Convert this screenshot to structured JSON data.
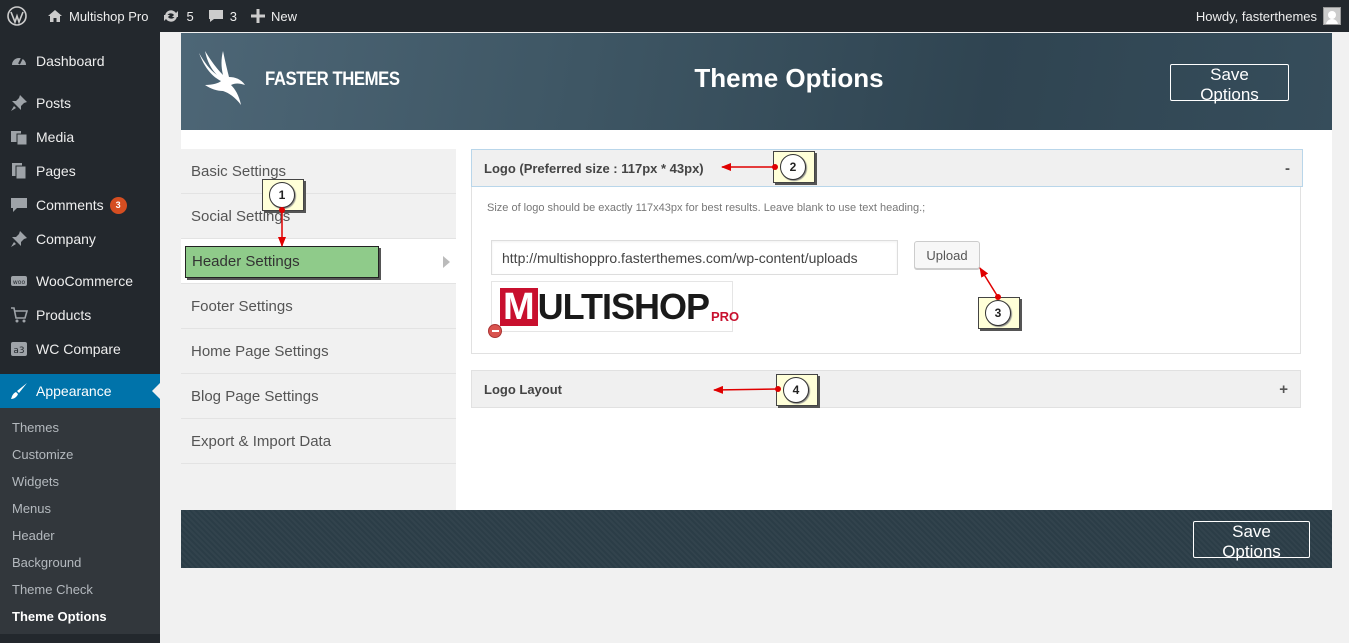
{
  "adminbar": {
    "site_name": "Multishop Pro",
    "updates_count": "5",
    "comments_count": "3",
    "new_label": "New",
    "howdy": "Howdy, fasterthemes"
  },
  "sidebar": {
    "items": [
      {
        "label": "Dashboard",
        "icon": "dashboard-icon"
      },
      {
        "label": "Posts",
        "icon": "pin-icon"
      },
      {
        "label": "Media",
        "icon": "media-icon"
      },
      {
        "label": "Pages",
        "icon": "pages-icon"
      },
      {
        "label": "Comments",
        "icon": "comments-icon",
        "badge": "3"
      },
      {
        "label": "Company",
        "icon": "pin-icon"
      },
      {
        "label": "WooCommerce",
        "icon": "woo-icon"
      },
      {
        "label": "Products",
        "icon": "cart-icon"
      },
      {
        "label": "WC Compare",
        "icon": "compare-icon"
      },
      {
        "label": "Appearance",
        "icon": "brush-icon"
      }
    ],
    "submenu": [
      "Themes",
      "Customize",
      "Widgets",
      "Menus",
      "Header",
      "Background",
      "Theme Check",
      "Theme Options"
    ]
  },
  "panel": {
    "brand": "FASTER THEMES",
    "title": "Theme Options",
    "save_label": "Save Options"
  },
  "tabs": [
    "Basic Settings",
    "Social Settings",
    "Header Settings",
    "Footer Settings",
    "Home Page Settings",
    "Blog Page Settings",
    "Export & Import Data"
  ],
  "logo_section": {
    "heading": "Logo (Preferred size : 117px * 43px)",
    "toggle": "-",
    "hint": "Size of logo should be exactly 117x43px for best results. Leave blank to use text heading.;",
    "url_value": "http://multishoppro.fasterthemes.com/wp-content/uploads",
    "upload_label": "Upload",
    "preview": {
      "m": "M",
      "rest": "ULTISHOP",
      "pro": "PRO"
    }
  },
  "layout_section": {
    "heading": "Logo Layout",
    "toggle": "+"
  },
  "callouts": [
    "1",
    "2",
    "3",
    "4"
  ],
  "colors": {
    "accent": "#0073aa",
    "highlight": "#8fcb8a",
    "arrow": "#e00000"
  }
}
